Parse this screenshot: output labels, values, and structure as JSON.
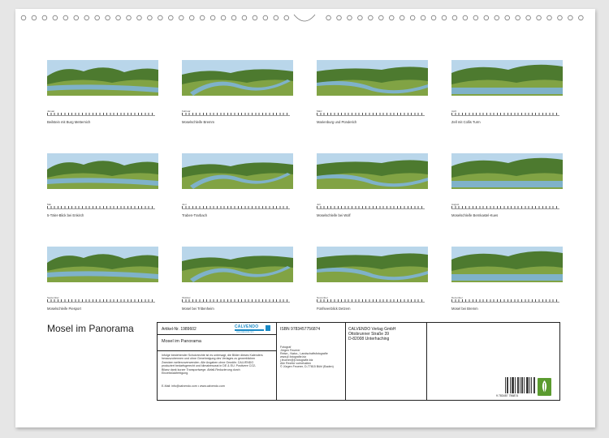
{
  "calendar": {
    "title": "Mosel im Panorama",
    "months": [
      {
        "month": "Januar",
        "caption": "Beilstein mit Burg Metternich"
      },
      {
        "month": "Februar",
        "caption": "Moselschleife Bremm"
      },
      {
        "month": "März",
        "caption": "Marienburg und Pünderich"
      },
      {
        "month": "April",
        "caption": "Zell mit Collis Turm"
      },
      {
        "month": "Mai",
        "caption": "5-Täler-Blick bei Enkirch"
      },
      {
        "month": "Juni",
        "caption": "Traben-Trarbach"
      },
      {
        "month": "Juli",
        "caption": "Moselschleife bei Wolf"
      },
      {
        "month": "August",
        "caption": "Moselschleife Bernkastel-Kues"
      },
      {
        "month": "September",
        "caption": "Moselschleife Piesport"
      },
      {
        "month": "Oktober",
        "caption": "Mosel bei Trittenheim"
      },
      {
        "month": "November",
        "caption": "Fünfseenblick Detzem"
      },
      {
        "month": "Dezember",
        "caption": "Mosel bei Bremm"
      }
    ]
  },
  "info_box": {
    "article_no": "Artikel-Nr. 1989602",
    "product_title": "Mosel im Panorama",
    "copyright_text": "Infolge bestehender Schutzrechte ist es untersagt, die Bilder dieses Kalenders herauszutrennen und ohne Genehmigung des Verlages zu gewerblichen Zwecken weiterzuverwenden. Alle Angaben ohne Gewähr. CALVENDO produziert bedarfsgerecht und klimabewusst in DE & EU. Postivere CO2-Bilanz dank kurzer Transportwege. Abfall-Reduzierung durch Einzelstückfertigung.",
    "email": "E-Mail: info@calvendo.com • www.calvendo.com",
    "isbn": "ISBN 9783457756874",
    "photographer_label": "Fotograf",
    "photographer_lines": [
      "Jürgen Feuerer",
      "Reise-, Natur-, Landschaftsfotografie",
      "www.jf-fotografie.biz",
      "j.feuerer@jf-fotografie.biz",
      "Alle Rechte vorbehalten",
      "© Jürgen Feuerer, D-77815 Bühl (Baden)"
    ],
    "publisher_lines": [
      "CALVENDO Verlag GmbH",
      "Ottobrunner Straße 39",
      "D-82008 Unterhaching"
    ],
    "logo_text": "CALVENDO",
    "logo_subtext": "www.calvendo.com",
    "barcode_digits": "9 783457 756874"
  },
  "colors": {
    "sky": "#b9d6ea",
    "hill": "#4d7a2f",
    "hill_light": "#8fae4a",
    "river": "#7fb2c9",
    "brand": "#1a8ac6",
    "fsc": "#5b9b2f"
  },
  "icons": [
    "binding-ring-icon",
    "hanger-notch-icon",
    "calvendo-logo-icon",
    "barcode-icon",
    "fsc-logo-icon"
  ]
}
